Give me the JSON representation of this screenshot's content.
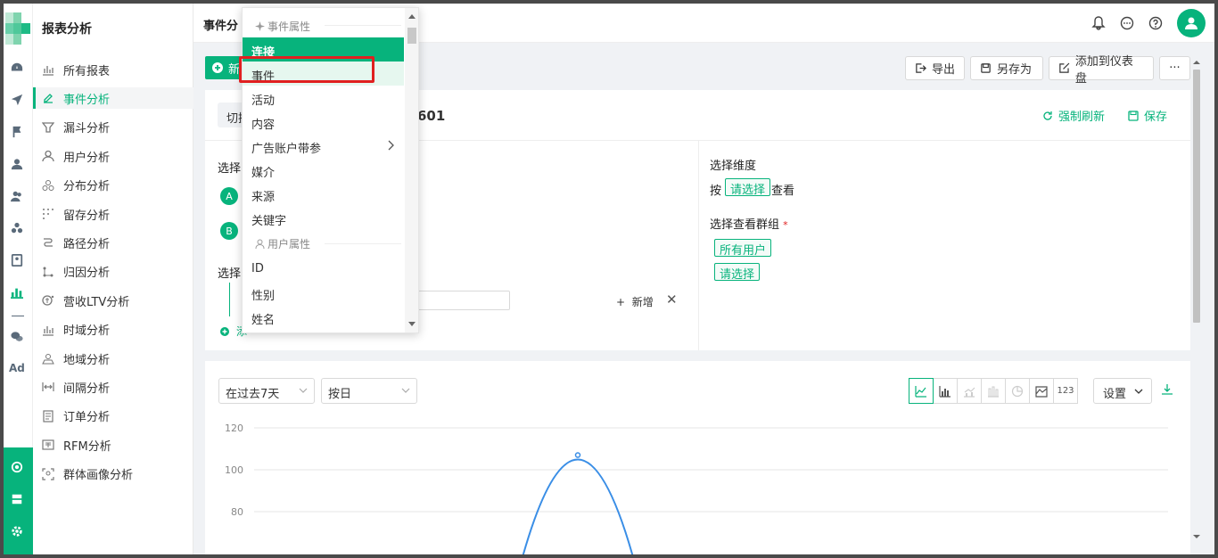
{
  "nav": {
    "title": "报表分析",
    "items": [
      {
        "label": "所有报表",
        "icon": "bar-chart-icon"
      },
      {
        "label": "事件分析",
        "icon": "edit-icon",
        "active": true
      },
      {
        "label": "漏斗分析",
        "icon": "funnel-icon"
      },
      {
        "label": "用户分析",
        "icon": "user-icon"
      },
      {
        "label": "分布分析",
        "icon": "distribution-icon"
      },
      {
        "label": "留存分析",
        "icon": "dots-grid-icon"
      },
      {
        "label": "路径分析",
        "icon": "path-icon"
      },
      {
        "label": "归因分析",
        "icon": "attribution-icon"
      },
      {
        "label": "营收LTV分析",
        "icon": "revenue-icon"
      },
      {
        "label": "时域分析",
        "icon": "bar-chart-icon"
      },
      {
        "label": "地域分析",
        "icon": "location-icon"
      },
      {
        "label": "间隔分析",
        "icon": "interval-icon"
      },
      {
        "label": "订单分析",
        "icon": "document-icon"
      },
      {
        "label": "RFM分析",
        "icon": "rfm-icon"
      },
      {
        "label": "群体画像分析",
        "icon": "portrait-icon"
      }
    ]
  },
  "rail": {
    "ad_label": "Ad"
  },
  "topbar": {
    "tab_title": "事件分"
  },
  "actions": {
    "new_label": "新",
    "export": "导出",
    "save_as": "另存为",
    "add_dashboard": "添加到仪表盘",
    "more": "···"
  },
  "panel1": {
    "switch_label": "切换",
    "report_name_suffix": "601",
    "force_refresh": "强制刷新",
    "save": "保存",
    "select_event_label": "选择",
    "event_a": "A",
    "event_b": "B",
    "select_filter_label": "选择",
    "add_label": "添",
    "add_new": "新增",
    "select_dimension": "选择维度",
    "by": "按",
    "please_select": "请选择",
    "view": "查看",
    "select_group": "选择查看群组",
    "required_mark": "*",
    "all_users": "所有用户",
    "please_select_2": "请选择"
  },
  "panel2": {
    "time_range": "在过去7天",
    "granularity": "按日",
    "chart_type_123": "123",
    "settings": "设置"
  },
  "chart_data": {
    "type": "line",
    "y_ticks": [
      120,
      100,
      80
    ],
    "ylim": [
      60,
      120
    ],
    "peak": {
      "y": 107
    },
    "series_color": "#3a8ee6"
  },
  "dropdown": {
    "group_event_props": "事件属性",
    "items_event": [
      {
        "label": "连接",
        "state": "selected"
      },
      {
        "label": "事件",
        "state": "highlight"
      },
      {
        "label": "活动"
      },
      {
        "label": "内容"
      },
      {
        "label": "广告账户带参",
        "has_submenu": true
      },
      {
        "label": "媒介"
      },
      {
        "label": "来源"
      },
      {
        "label": "关键字"
      }
    ],
    "group_user_props": "用户属性",
    "items_user": [
      {
        "label": "ID"
      },
      {
        "label": "性别"
      },
      {
        "label": "姓名"
      }
    ]
  },
  "colors": {
    "accent": "#07b37c",
    "highlight_box": "#e02020"
  }
}
